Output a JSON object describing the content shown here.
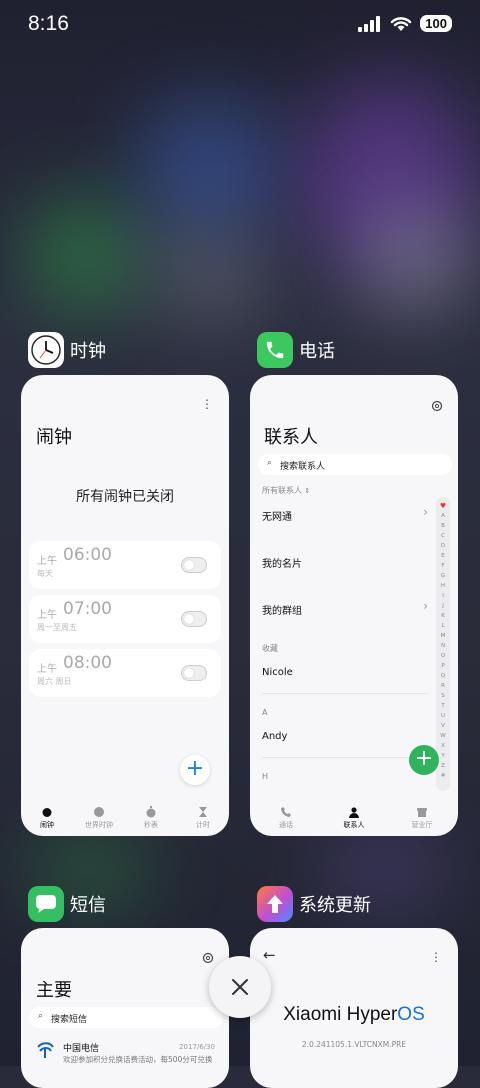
{
  "status": {
    "time": "8:16",
    "battery": "100"
  },
  "cards": {
    "clock": {
      "app_name": "时钟",
      "title": "闹钟",
      "all_off": "所有闹钟已关闭",
      "alarms": [
        {
          "ampm": "上午",
          "time": "06:00",
          "repeat": "每天"
        },
        {
          "ampm": "上午",
          "time": "07:00",
          "repeat": "周一至周五"
        },
        {
          "ampm": "上午",
          "time": "08:00",
          "repeat": "周六 周日"
        }
      ],
      "tabs": [
        "闹钟",
        "世界时钟",
        "秒表",
        "计时"
      ]
    },
    "phone": {
      "app_name": "电话",
      "title": "联系人",
      "search_placeholder": "搜索联系人",
      "filter": "所有联系人",
      "rows": {
        "wuwangtong": "无网通",
        "my_card": "我的名片",
        "my_groups": "我的群组",
        "favorites_header": "收藏",
        "nicole": "Nicole",
        "section_a": "A",
        "andy": "Andy",
        "section_h": "H"
      },
      "index_letters": "A B C D E F G H I J K L M N O P Q R S T U V W X Y Z #",
      "tabs": [
        "通话",
        "联系人",
        "营业厅"
      ]
    },
    "messages": {
      "app_name": "短信",
      "title": "主要",
      "search_placeholder": "搜索短信",
      "thread": {
        "sender": "中国电信",
        "date": "2017/6/30",
        "preview": "欢迎参加积分兑换话费活动，每500分可兑换"
      }
    },
    "update": {
      "app_name": "系统更新",
      "brand": "Xiaomi HyperOS",
      "brand_prefix": "Xiaomi Hyper",
      "brand_suffix": "OS",
      "version": "2.0.241105.1.VLTCNXM.PRE"
    }
  },
  "colors": {
    "accent": "#1a7fe6",
    "green": "#2fb35f"
  }
}
